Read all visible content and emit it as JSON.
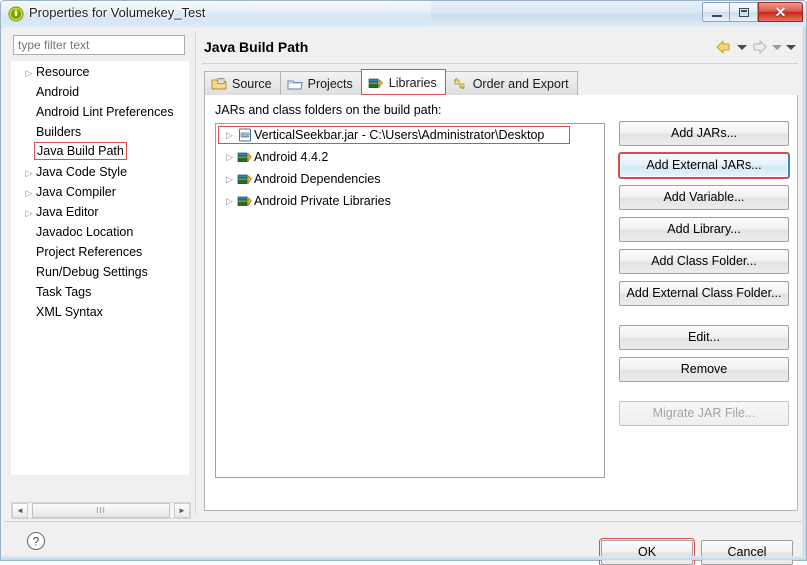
{
  "window": {
    "title": "Properties for Volumekey_Test",
    "icon": "eclipse-logo-icon",
    "buttons": {
      "minimize": "minimize-icon",
      "maximize": "maximize-icon",
      "close": "✕"
    }
  },
  "sidebar": {
    "filter": {
      "value": "",
      "placeholder": "type filter text"
    },
    "items": [
      {
        "label": "Resource",
        "expandable": true,
        "selected": false
      },
      {
        "label": "Android",
        "expandable": false,
        "selected": false
      },
      {
        "label": "Android Lint Preferences",
        "expandable": false,
        "selected": false
      },
      {
        "label": "Builders",
        "expandable": false,
        "selected": false
      },
      {
        "label": "Java Build Path",
        "expandable": false,
        "selected": true
      },
      {
        "label": "Java Code Style",
        "expandable": true,
        "selected": false
      },
      {
        "label": "Java Compiler",
        "expandable": true,
        "selected": false
      },
      {
        "label": "Java Editor",
        "expandable": true,
        "selected": false
      },
      {
        "label": "Javadoc Location",
        "expandable": false,
        "selected": false
      },
      {
        "label": "Project References",
        "expandable": false,
        "selected": false
      },
      {
        "label": "Run/Debug Settings",
        "expandable": false,
        "selected": false
      },
      {
        "label": "Task Tags",
        "expandable": false,
        "selected": false
      },
      {
        "label": "XML Syntax",
        "expandable": false,
        "selected": false
      }
    ],
    "scrollbar": {
      "left_arrow": "◄",
      "right_arrow": "►",
      "thumb_grip": "III"
    }
  },
  "page": {
    "title": "Java Build Path",
    "nav": {
      "back": "back-arrow-icon",
      "back_menu": "chevron-down-icon",
      "forward": "forward-arrow-icon",
      "forward_menu": "chevron-down-icon",
      "view_menu": "chevron-down-icon"
    },
    "tabs": [
      {
        "label": "Source",
        "icon": "package-folder-icon",
        "selected": false,
        "annotated": false
      },
      {
        "label": "Projects",
        "icon": "project-folder-icon",
        "selected": false,
        "annotated": false
      },
      {
        "label": "Libraries",
        "icon": "library-books-icon",
        "selected": true,
        "annotated": true
      },
      {
        "label": "Order and Export",
        "icon": "order-export-icon",
        "selected": false,
        "annotated": false
      }
    ],
    "list_label": "JARs and class folders on the build path:",
    "entries": [
      {
        "label": "VerticalSeekbar.jar - C:\\Users\\Administrator\\Desktop",
        "icon": "jar-file-icon",
        "expandable": true,
        "annotated": true
      },
      {
        "label": "Android 4.4.2",
        "icon": "library-books-icon",
        "expandable": true,
        "annotated": false
      },
      {
        "label": "Android Dependencies",
        "icon": "library-books-icon",
        "expandable": true,
        "annotated": false
      },
      {
        "label": "Android Private Libraries",
        "icon": "library-books-icon",
        "expandable": true,
        "annotated": false
      }
    ],
    "side_buttons": [
      {
        "label": "Add JARs...",
        "state": "normal",
        "annotated": false,
        "gap_after": false
      },
      {
        "label": "Add External JARs...",
        "state": "focused",
        "annotated": true,
        "gap_after": false
      },
      {
        "label": "Add Variable...",
        "state": "normal",
        "annotated": false,
        "gap_after": false
      },
      {
        "label": "Add Library...",
        "state": "normal",
        "annotated": false,
        "gap_after": false
      },
      {
        "label": "Add Class Folder...",
        "state": "normal",
        "annotated": false,
        "gap_after": false
      },
      {
        "label": "Add External Class Folder...",
        "state": "normal",
        "annotated": false,
        "gap_after": true
      },
      {
        "label": "Edit...",
        "state": "normal",
        "annotated": false,
        "gap_after": false
      },
      {
        "label": "Remove",
        "state": "normal",
        "annotated": false,
        "gap_after": true
      },
      {
        "label": "Migrate JAR File...",
        "state": "disabled",
        "annotated": false,
        "gap_after": false
      }
    ]
  },
  "footer": {
    "help": "help-icon",
    "ok": "OK",
    "cancel": "Cancel"
  },
  "colors": {
    "annotation": "#d74f4f",
    "focus": "#3c7fb1",
    "title_text": "#1f1f2b"
  }
}
